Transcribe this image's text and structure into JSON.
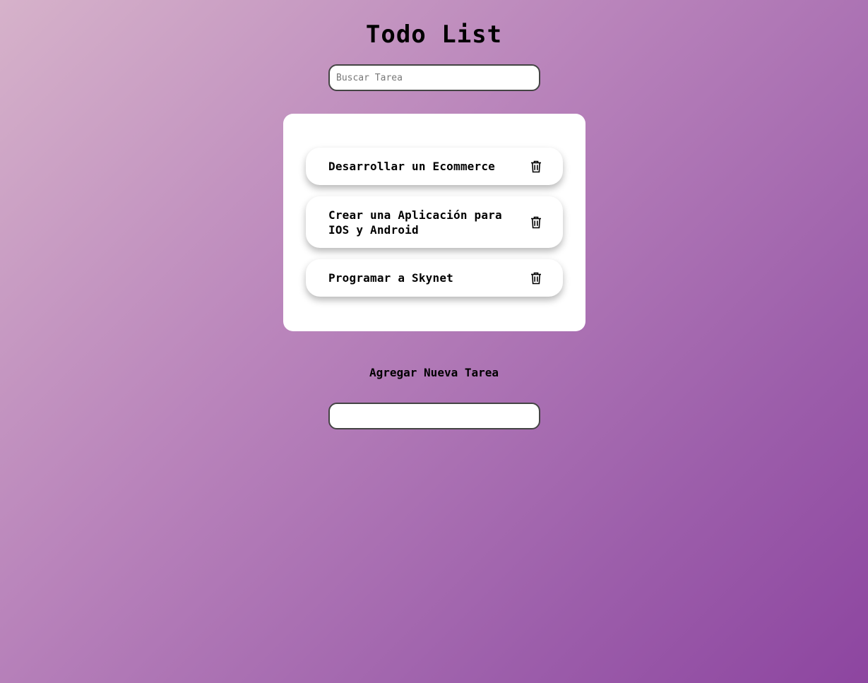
{
  "header": {
    "title": "Todo List"
  },
  "search": {
    "placeholder": "Buscar Tarea",
    "value": ""
  },
  "todos": {
    "items": [
      {
        "text": "Desarrollar un Ecommerce",
        "delete_icon": "trash-icon"
      },
      {
        "text": "Crear una Aplicación para IOS y Android",
        "delete_icon": "trash-icon"
      },
      {
        "text": "Programar a Skynet",
        "delete_icon": "trash-icon"
      }
    ]
  },
  "new_task": {
    "label": "Agregar Nueva Tarea",
    "placeholder": "",
    "value": ""
  },
  "colors": {
    "background_start": "#d6b2ca",
    "background_end": "#8d45a0",
    "card": "#ffffff"
  }
}
